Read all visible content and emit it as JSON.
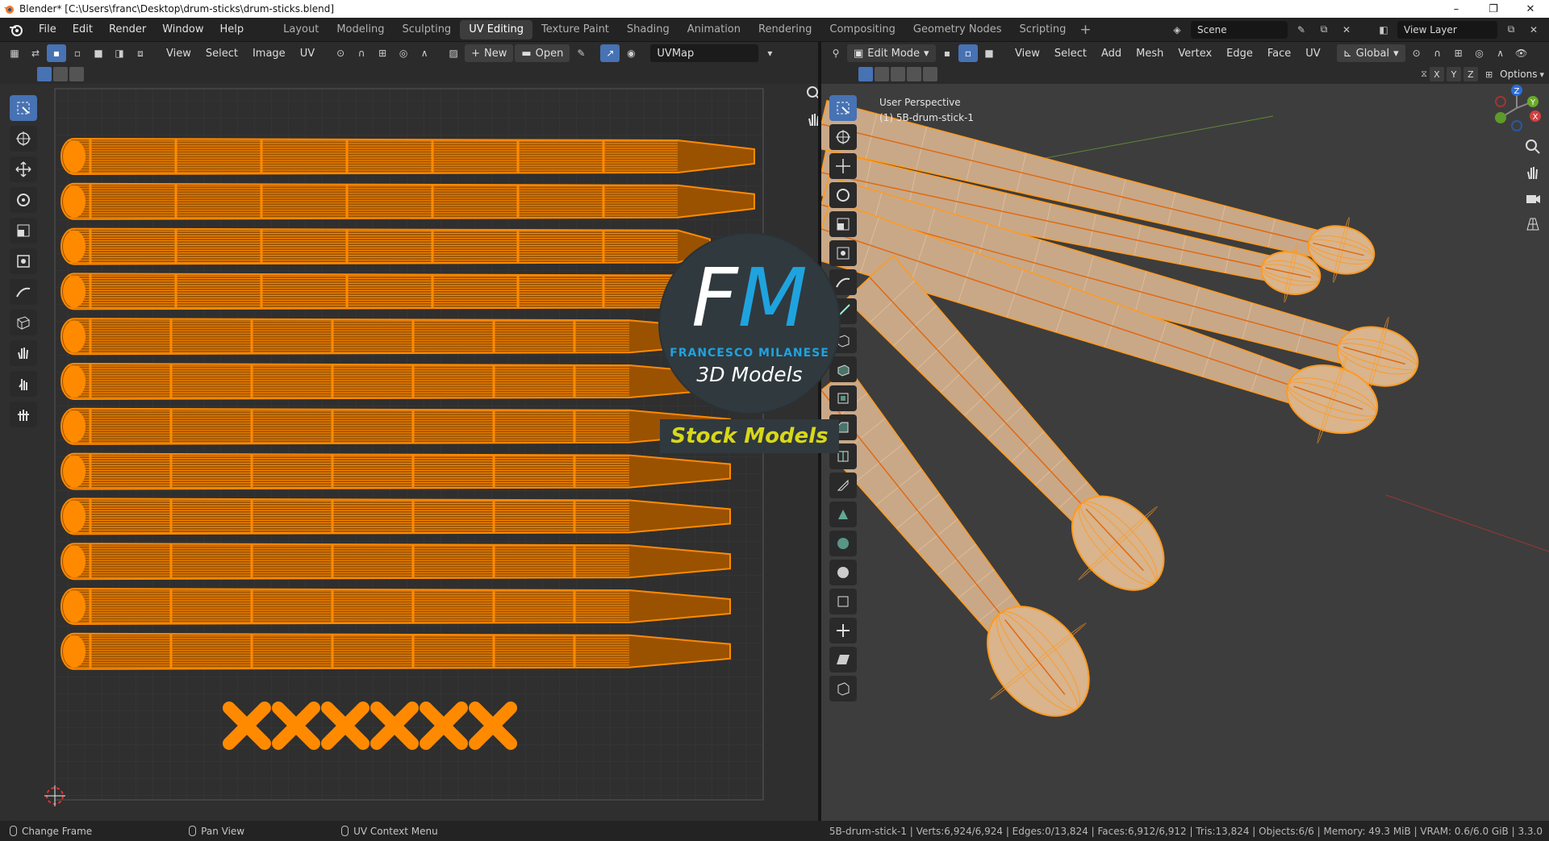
{
  "window": {
    "title": "Blender* [C:\\Users\\franc\\Desktop\\drum-sticks\\drum-sticks.blend]",
    "controls": [
      "–",
      "❐",
      "✕"
    ]
  },
  "menu": {
    "items": [
      "File",
      "Edit",
      "Render",
      "Window",
      "Help"
    ],
    "workspaces": [
      "Layout",
      "Modeling",
      "Sculpting",
      "UV Editing",
      "Texture Paint",
      "Shading",
      "Animation",
      "Rendering",
      "Compositing",
      "Geometry Nodes",
      "Scripting"
    ],
    "active_workspace": "UV Editing",
    "scene": "Scene",
    "view_layer": "View Layer"
  },
  "uv_header": {
    "menus": [
      "View",
      "Select",
      "Image",
      "UV"
    ],
    "new_label": "New",
    "open_label": "Open",
    "uvmap": "UVMap"
  },
  "vp_header": {
    "mode": "Edit Mode",
    "menus": [
      "View",
      "Select",
      "Add",
      "Mesh",
      "Vertex",
      "Edge",
      "Face",
      "UV"
    ],
    "orientation": "Global",
    "options": "Options",
    "axes": [
      "X",
      "Y",
      "Z"
    ]
  },
  "viewport": {
    "view_name": "User Perspective",
    "object": "(1) 5B-drum-stick-1"
  },
  "gizmo": {
    "z": "Z",
    "y": "Y",
    "x": "X"
  },
  "watermark": {
    "logo_f": "F",
    "logo_m": "M",
    "author": "FRANCESCO MILANESE",
    "tagline": "3D Models",
    "badge": "Stock Models"
  },
  "status": {
    "hint1": "Change Frame",
    "hint2": "Pan View",
    "hint3": "UV Context Menu",
    "stats": "5B-drum-stick-1 | Verts:6,924/6,924 | Edges:0/13,824 | Faces:6,912/6,912 | Tris:13,824 | Objects:6/6 | Memory: 49.3 MiB | VRAM: 0.6/6.0 GiB | 3.3.0"
  },
  "colors": {
    "accent": "#4772b3",
    "uv_orange": "#ff8a00",
    "wire_orange": "#ff9a1e",
    "mesh": "#d9b48c",
    "watermark_blue": "#1fa3df",
    "watermark_yellow": "#d8d81a"
  }
}
